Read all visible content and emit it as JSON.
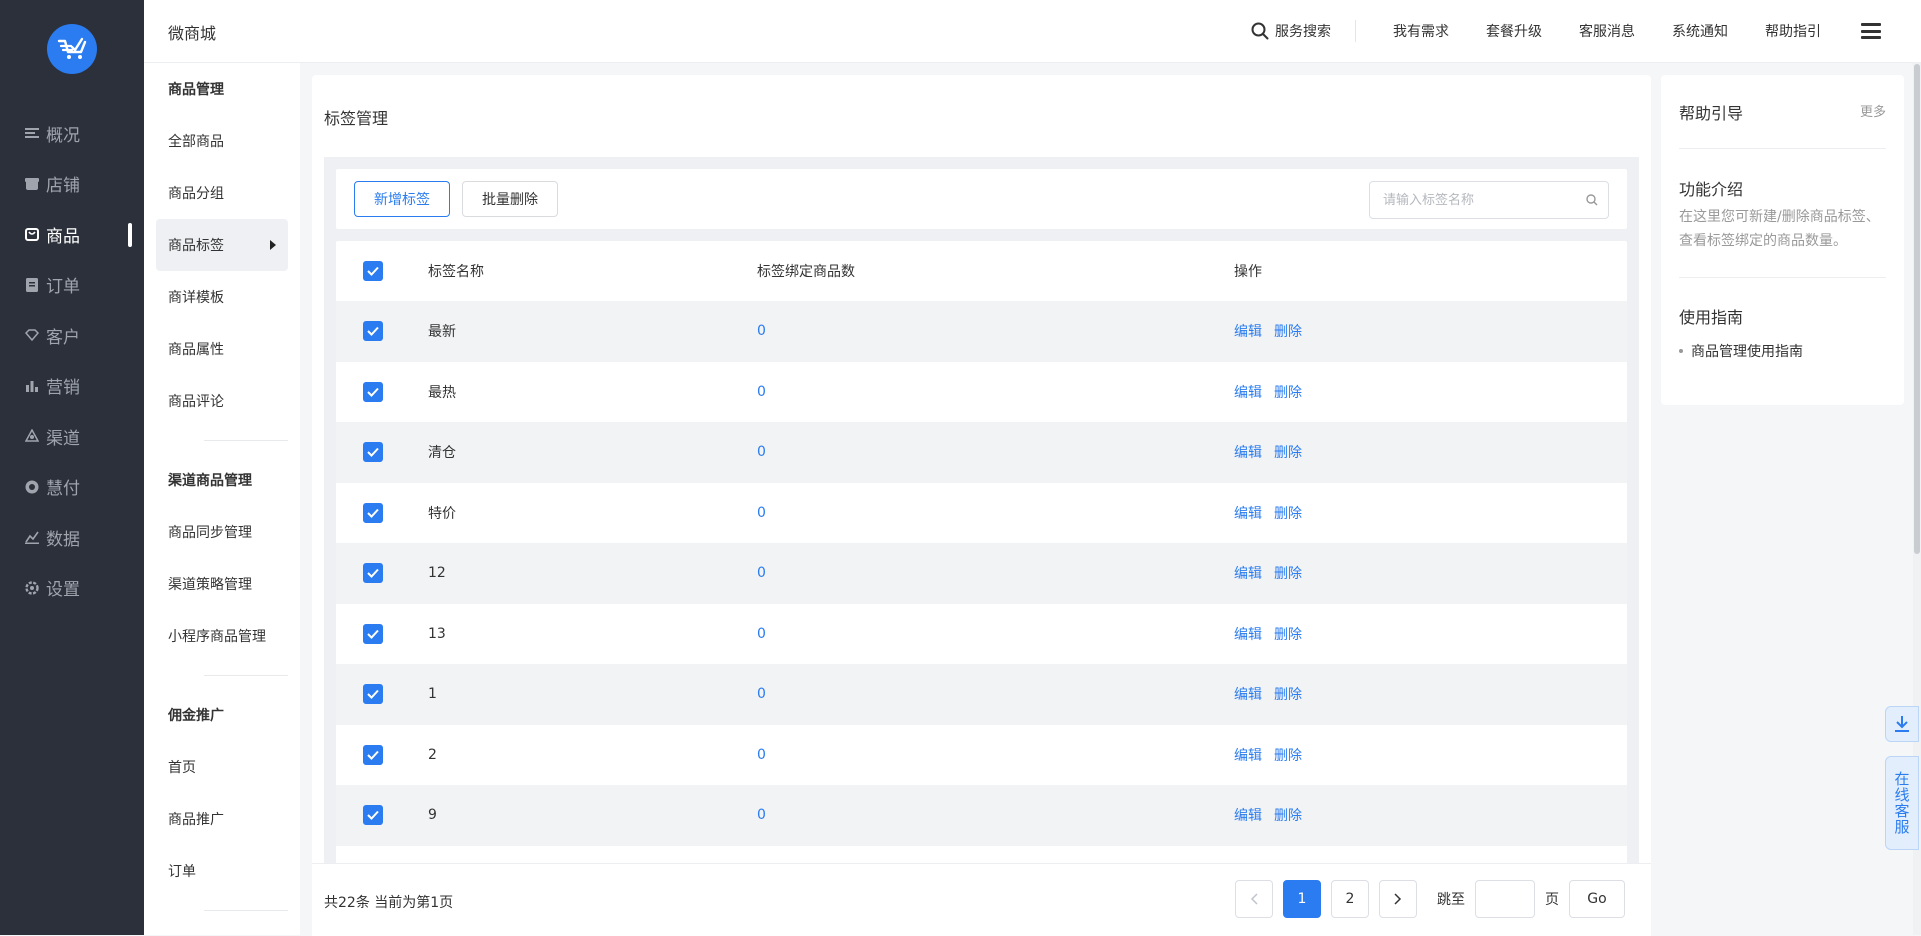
{
  "app": {
    "brand": "微商城"
  },
  "colors": {
    "accent": "#2a7cf0",
    "sidebar_bg": "#2b303b"
  },
  "sidebar": {
    "items": [
      {
        "label": "概况",
        "icon": "overview-icon"
      },
      {
        "label": "店铺",
        "icon": "store-icon"
      },
      {
        "label": "商品",
        "icon": "goods-icon",
        "active": true
      },
      {
        "label": "订单",
        "icon": "order-icon"
      },
      {
        "label": "客户",
        "icon": "customer-icon"
      },
      {
        "label": "营销",
        "icon": "marketing-icon"
      },
      {
        "label": "渠道",
        "icon": "channel-icon"
      },
      {
        "label": "慧付",
        "icon": "pay-icon"
      },
      {
        "label": "数据",
        "icon": "data-icon"
      },
      {
        "label": "设置",
        "icon": "settings-icon"
      }
    ]
  },
  "header": {
    "search": "服务搜索",
    "links": [
      "我有需求",
      "套餐升级",
      "客服消息",
      "系统通知",
      "帮助指引"
    ]
  },
  "subnav": {
    "group1": {
      "title": "商品管理",
      "items": [
        "全部商品",
        "商品分组",
        "商品标签",
        "商详模板",
        "商品属性",
        "商品评论"
      ]
    },
    "group2": {
      "title": "渠道商品管理",
      "items": [
        "商品同步管理",
        "渠道策略管理",
        "小程序商品管理"
      ]
    },
    "group3": {
      "title": "佣金推广",
      "items": [
        "首页",
        "商品推广",
        "订单"
      ]
    }
  },
  "main": {
    "title": "标签管理",
    "add_button": "新增标签",
    "batch_delete_button": "批量删除",
    "search_placeholder": "请输入标签名称",
    "columns": [
      "标签名称",
      "标签绑定商品数",
      "操作"
    ],
    "rows": [
      {
        "name": "最新",
        "count": "0"
      },
      {
        "name": "最热",
        "count": "0"
      },
      {
        "name": "清仓",
        "count": "0"
      },
      {
        "name": "特价",
        "count": "0"
      },
      {
        "name": "12",
        "count": "0"
      },
      {
        "name": "13",
        "count": "0"
      },
      {
        "name": "1",
        "count": "0"
      },
      {
        "name": "2",
        "count": "0"
      },
      {
        "name": "9",
        "count": "0"
      }
    ],
    "op_edit": "编辑",
    "op_delete": "删除"
  },
  "pagination": {
    "summary": "共22条 当前为第1页",
    "pages": [
      "1",
      "2"
    ],
    "current": "1",
    "jump_label": "跳至",
    "page_unit": "页",
    "go": "Go"
  },
  "help": {
    "title": "帮助引导",
    "more": "更多",
    "section1_title": "功能介绍",
    "section1_desc": "在这里您可新建/删除商品标签、查看标签绑定的商品数量。",
    "section2_title": "使用指南",
    "guide_link": "商品管理使用指南"
  },
  "floating": {
    "customer_service": "在线客服"
  }
}
